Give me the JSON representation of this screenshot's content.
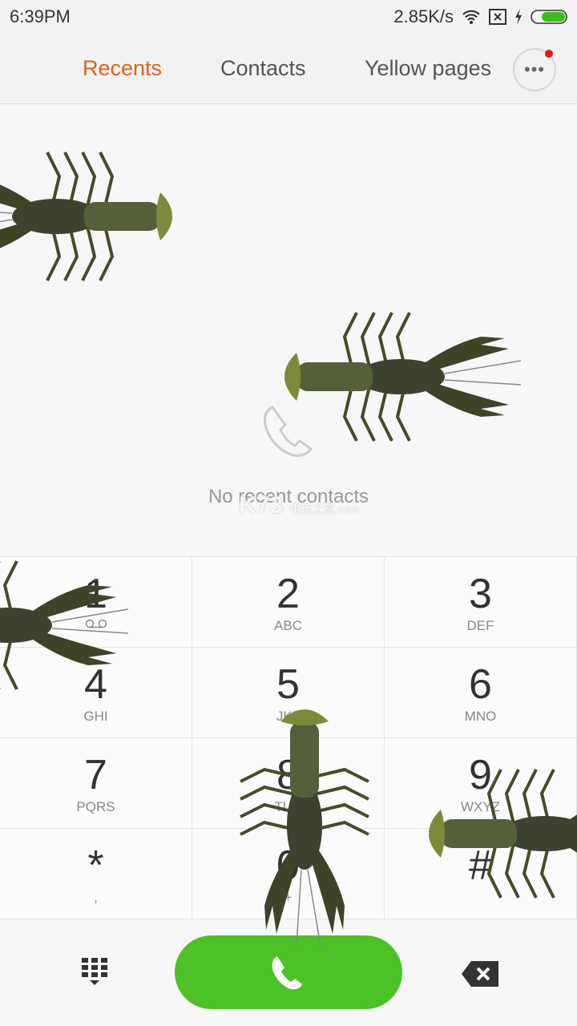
{
  "status": {
    "time": "6:39PM",
    "speed": "2.85K/s",
    "icons": [
      "wifi-icon",
      "sim-off-icon",
      "charging-icon",
      "battery-icon"
    ],
    "battery_color": "#3dbb1b"
  },
  "tabs": [
    {
      "label": "Recents",
      "active": true
    },
    {
      "label": "Contacts"
    },
    {
      "label": "Yellow pages"
    }
  ],
  "accent": "#e0621f",
  "empty": {
    "text": "No recent contacts",
    "icon": "phone-outline-icon"
  },
  "watermark": {
    "main": "K73",
    "cn": "电玩之家",
    "domain": ".com"
  },
  "keys": [
    {
      "digit": "1",
      "letters": ""
    },
    {
      "digit": "2",
      "letters": "ABC"
    },
    {
      "digit": "3",
      "letters": "DEF"
    },
    {
      "digit": "4",
      "letters": "GHI"
    },
    {
      "digit": "5",
      "letters": "JKL"
    },
    {
      "digit": "6",
      "letters": "MNO"
    },
    {
      "digit": "7",
      "letters": "PQRS"
    },
    {
      "digit": "8",
      "letters": "TUV"
    },
    {
      "digit": "9",
      "letters": "WXYZ"
    },
    {
      "digit": "*",
      "letters": ","
    },
    {
      "digit": "0",
      "letters": "+"
    },
    {
      "digit": "#",
      "letters": ""
    }
  ],
  "call_color": "#4dc128"
}
